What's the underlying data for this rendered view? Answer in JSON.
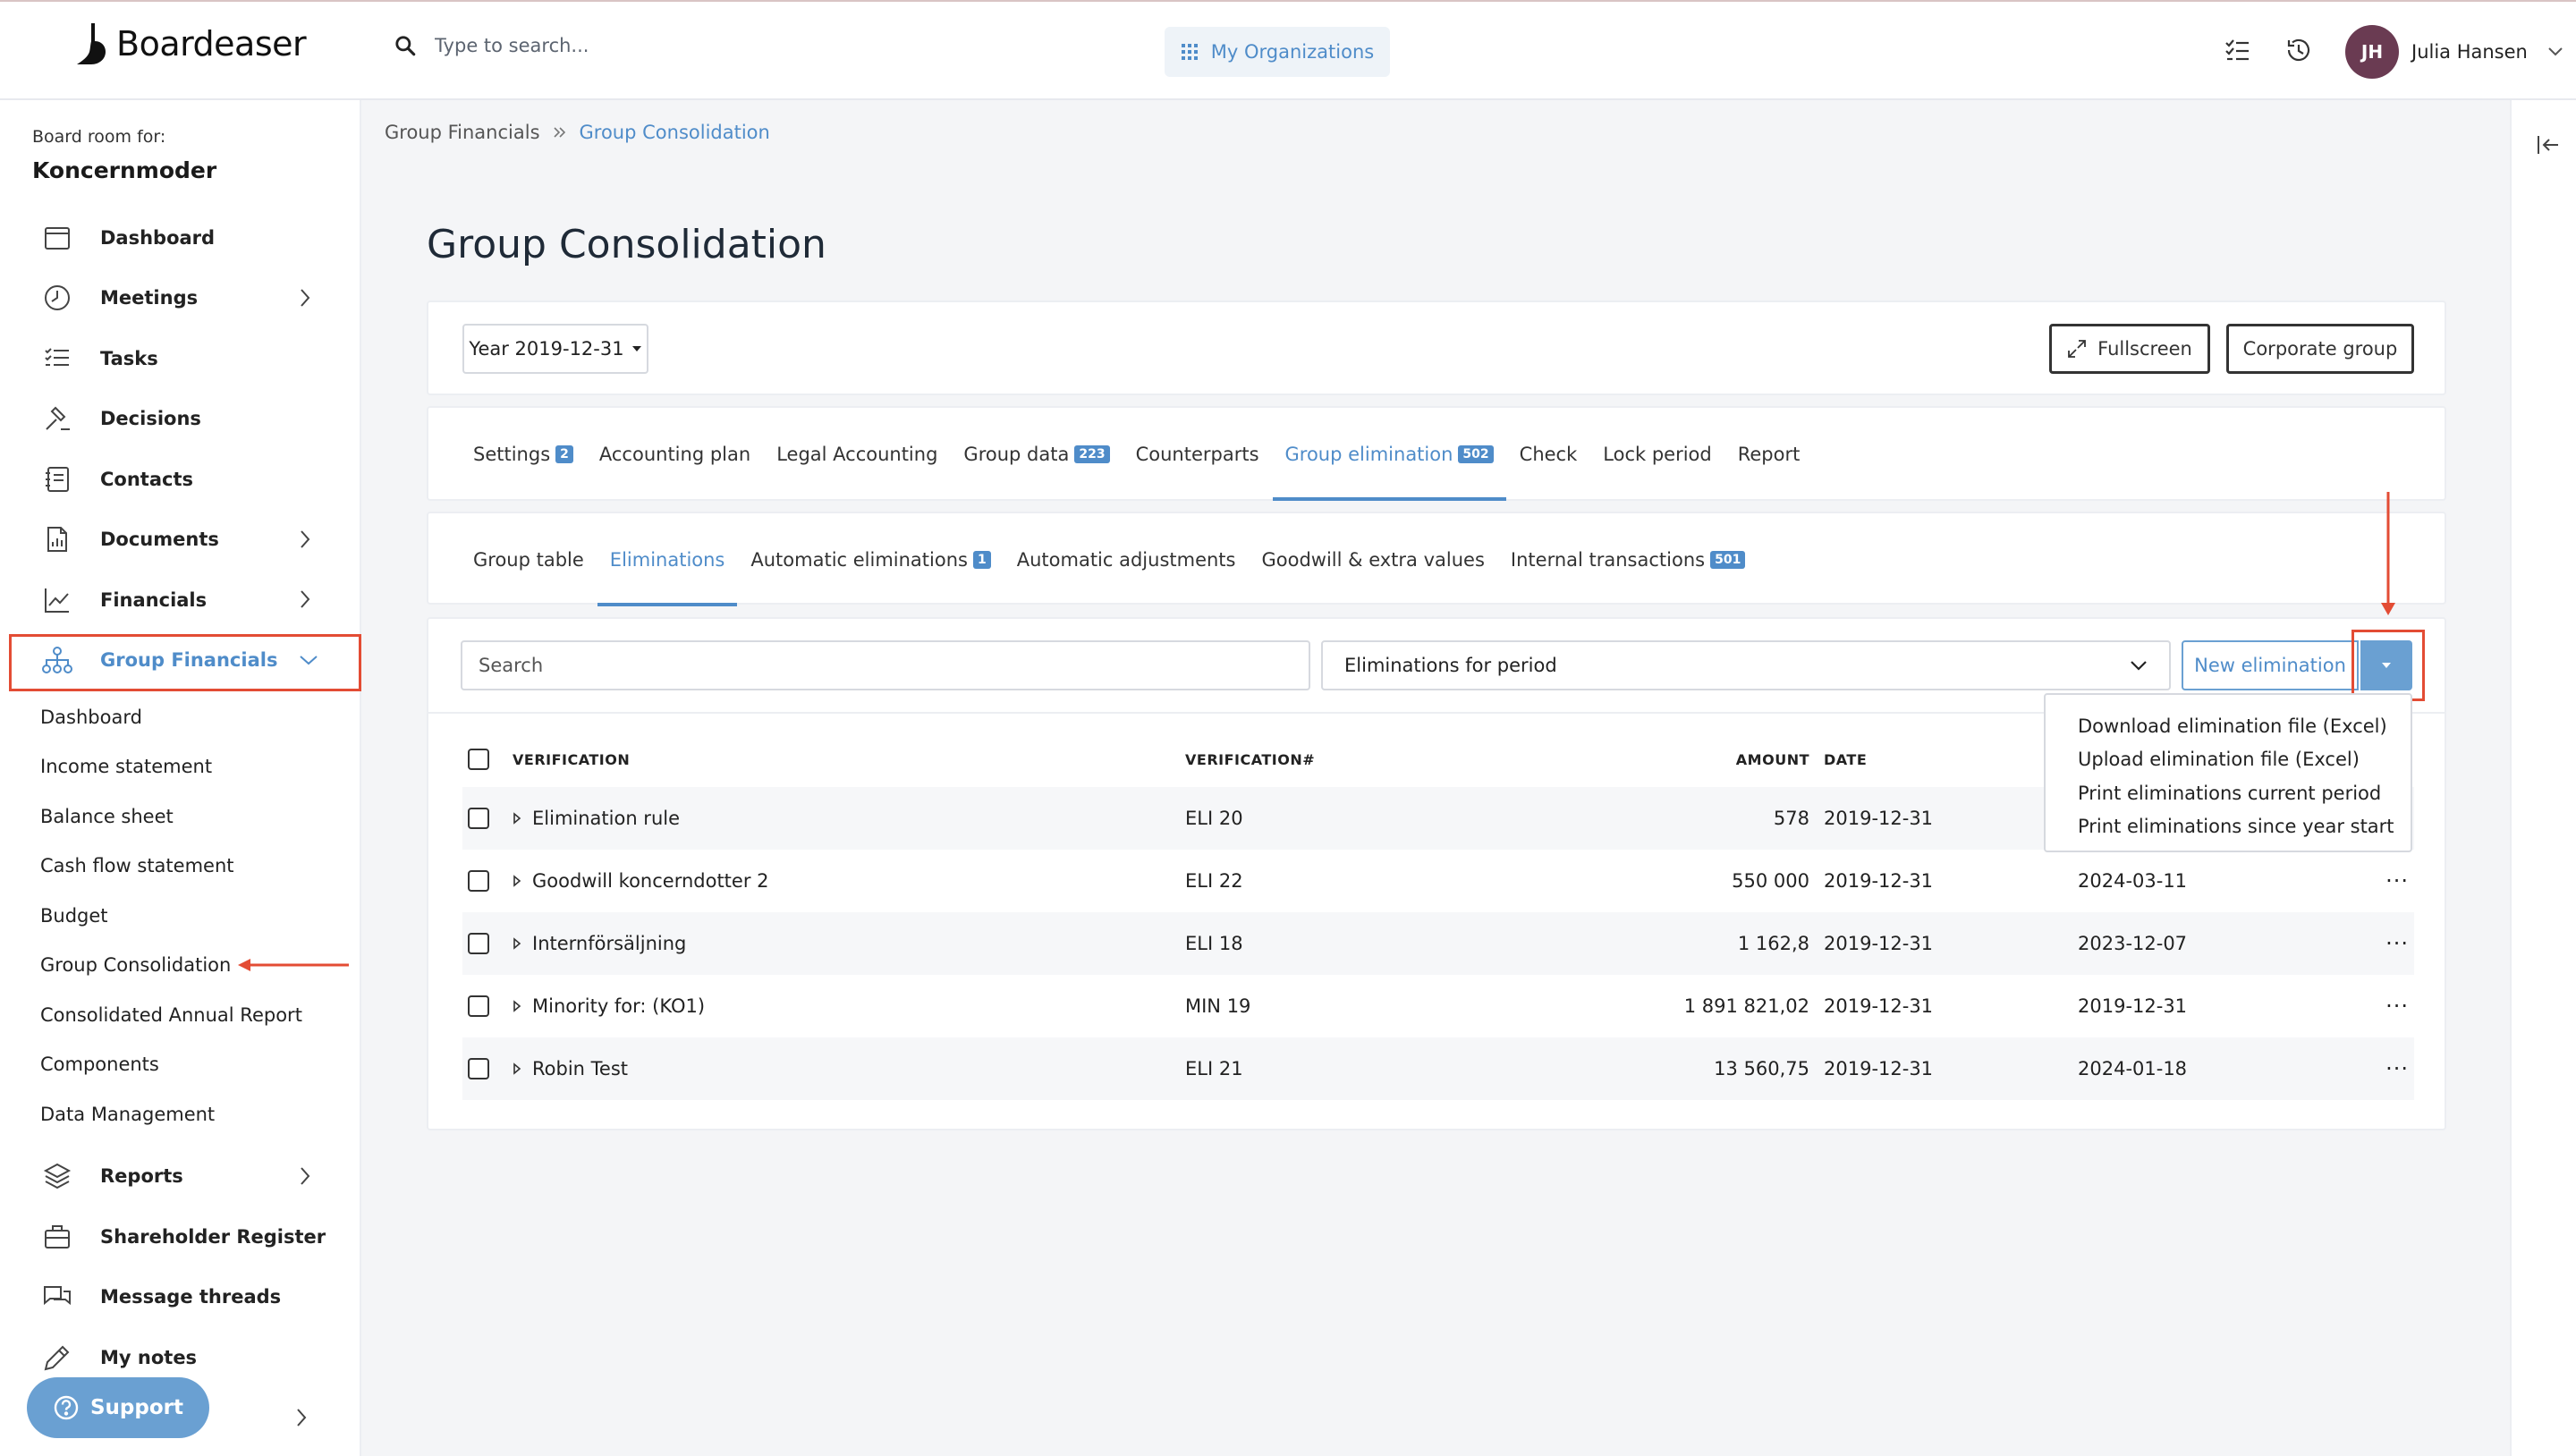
{
  "app": {
    "name": "Boardeaser"
  },
  "header": {
    "search_placeholder": "Type to search...",
    "org_button": "My Organizations",
    "user": {
      "initials": "JH",
      "name": "Julia Hansen"
    }
  },
  "sidebar": {
    "board_for_label": "Board room for:",
    "board_name": "Koncernmoder",
    "items": [
      {
        "label": "Dashboard",
        "icon": "calendar-icon"
      },
      {
        "label": "Meetings",
        "icon": "clock-icon"
      },
      {
        "label": "Tasks",
        "icon": "tasks-icon"
      },
      {
        "label": "Decisions",
        "icon": "gavel-icon"
      },
      {
        "label": "Contacts",
        "icon": "address-book-icon"
      },
      {
        "label": "Documents",
        "icon": "document-icon"
      },
      {
        "label": "Financials",
        "icon": "line-chart-icon"
      },
      {
        "label": "Group Financials",
        "icon": "org-chart-icon"
      }
    ],
    "group_sub": [
      "Dashboard",
      "Income statement",
      "Balance sheet",
      "Cash flow statement",
      "Budget",
      "Group Consolidation",
      "Consolidated Annual Report",
      "Components",
      "Data Management"
    ],
    "items_after": [
      {
        "label": "Reports",
        "icon": "layers-icon"
      },
      {
        "label": "Shareholder Register",
        "icon": "briefcase-icon"
      },
      {
        "label": "Message threads",
        "icon": "chat-icon"
      },
      {
        "label": "My notes",
        "icon": "pencil-icon"
      }
    ],
    "support_label": "Support"
  },
  "breadcrumb": {
    "parent": "Group Financials",
    "current": "Group Consolidation"
  },
  "page": {
    "title": "Group Consolidation"
  },
  "toolbar": {
    "year": "Year 2019-12-31",
    "fullscreen": "Fullscreen",
    "corporate_group": "Corporate group"
  },
  "tabs": [
    {
      "label": "Settings",
      "badge": "2"
    },
    {
      "label": "Accounting plan"
    },
    {
      "label": "Legal Accounting"
    },
    {
      "label": "Group data",
      "badge": "223"
    },
    {
      "label": "Counterparts"
    },
    {
      "label": "Group elimination",
      "badge": "502"
    },
    {
      "label": "Check"
    },
    {
      "label": "Lock period"
    },
    {
      "label": "Report"
    }
  ],
  "subtabs": [
    {
      "label": "Group table"
    },
    {
      "label": "Eliminations"
    },
    {
      "label": "Automatic eliminations",
      "badge": "1"
    },
    {
      "label": "Automatic adjustments"
    },
    {
      "label": "Goodwill & extra values"
    },
    {
      "label": "Internal transactions",
      "badge": "501"
    }
  ],
  "filters": {
    "search_placeholder": "Search",
    "period_select": "Eliminations for period",
    "new_button": "New elimination"
  },
  "table": {
    "columns": [
      "VERIFICATION",
      "VERIFICATION#",
      "AMOUNT",
      "DATE"
    ],
    "rows": [
      {
        "name": "Elimination rule",
        "num": "ELI 20",
        "amount": "578",
        "date": "2019-12-31",
        "date2": ""
      },
      {
        "name": "Goodwill koncerndotter 2",
        "num": "ELI 22",
        "amount": "550 000",
        "date": "2019-12-31",
        "date2": "2024-03-11"
      },
      {
        "name": "Internförsäljning",
        "num": "ELI 18",
        "amount": "1 162,8",
        "date": "2019-12-31",
        "date2": "2023-12-07"
      },
      {
        "name": "Minority for: (KO1)",
        "num": "MIN 19",
        "amount": "1 891 821,02",
        "date": "2019-12-31",
        "date2": "2019-12-31"
      },
      {
        "name": "Robin Test",
        "num": "ELI 21",
        "amount": "13 560,75",
        "date": "2019-12-31",
        "date2": "2024-01-18"
      }
    ],
    "row_menu": "···"
  },
  "dropdown": {
    "items": [
      "Download elimination file (Excel)",
      "Upload elimination file (Excel)",
      "Print eliminations current period",
      "Print eliminations since year start"
    ]
  },
  "colors": {
    "accent": "#4f8cc9",
    "highlight": "#e34c34",
    "avatar": "#6a3b52"
  }
}
